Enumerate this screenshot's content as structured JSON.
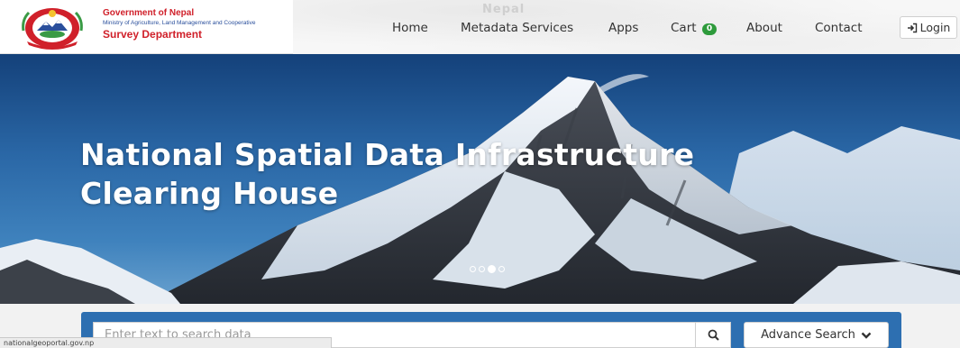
{
  "header": {
    "org_line1": "Government of Nepal",
    "org_line2": "Ministry of Agriculture, Land Management and Cooperative",
    "org_line3": "Survey Department",
    "map_label": "Nepal",
    "nav": {
      "home": "Home",
      "metadata": "Metadata Services",
      "apps": "Apps",
      "cart": "Cart",
      "cart_count": "0",
      "about": "About",
      "contact": "Contact"
    },
    "login_label": "Login"
  },
  "hero": {
    "title_line1": "National Spatial Data Infrastructure",
    "title_line2": "Clearing House",
    "carousel_total": 4,
    "carousel_active": 3
  },
  "search": {
    "placeholder": "Enter text to search data",
    "advance_label": "Advance Search"
  },
  "status_bar": {
    "url": "nationalgeoportal.gov.np"
  },
  "colors": {
    "brand_red": "#d0202a",
    "brand_blue": "#2a4f9c",
    "search_panel": "#2d6fb1",
    "cart_badge": "#2e9b3c"
  },
  "icons": {
    "login": "sign-in-icon",
    "search": "search-icon",
    "advance": "chevron-down-icon",
    "logo": "nepal-emblem"
  }
}
